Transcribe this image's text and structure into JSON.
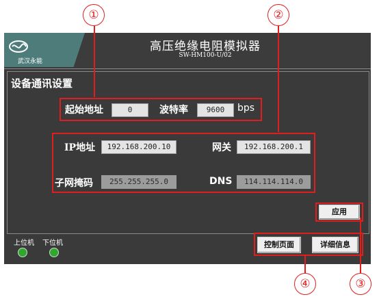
{
  "header": {
    "logo_text": "武汉永能",
    "title": "高压绝缘电阻模拟器",
    "subtitle": "SW-HM100-U/02"
  },
  "section": {
    "title": "设备通讯设置"
  },
  "comm": {
    "start_addr_label": "起始地址",
    "start_addr_value": "0",
    "baud_label": "波特率",
    "baud_value": "9600",
    "baud_unit": "bps"
  },
  "network": {
    "ip_label": "IP地址",
    "ip_value": "192.168.200.10",
    "gateway_label": "网关",
    "gateway_value": "192.168.200.1",
    "mask_label": "子网掩码",
    "mask_value": "255.255.255.0",
    "dns_label": "DNS",
    "dns_value": "114.114.114.0"
  },
  "buttons": {
    "apply": "应用",
    "control_page": "控制页面",
    "detail_info": "详细信息"
  },
  "status": {
    "upper": "上位机",
    "lower": "下位机"
  },
  "callouts": [
    "①",
    "②",
    "③",
    "④"
  ],
  "colors": {
    "annotation": "#e11d1d",
    "led": "#2fa82f",
    "screen_bg": "#3a3a3a"
  },
  "icons": {
    "logo": "brand-logo-icon"
  }
}
